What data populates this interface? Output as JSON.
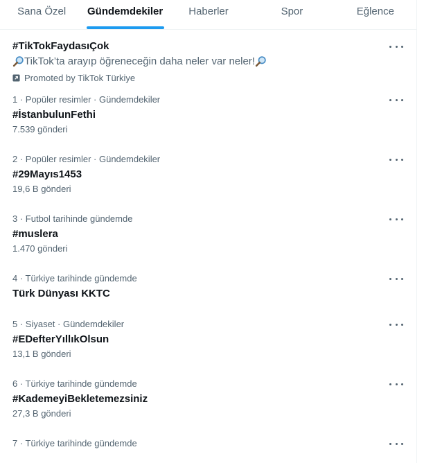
{
  "tabs": [
    {
      "label": "Sana Özel",
      "active": false
    },
    {
      "label": "Gündemdekiler",
      "active": true
    },
    {
      "label": "Haberler",
      "active": false
    },
    {
      "label": "Spor",
      "active": false
    },
    {
      "label": "Eğlence",
      "active": false
    }
  ],
  "promoted": {
    "title": "#TikTokFaydasıÇok",
    "description": "TikTok’ta arayıp öğreneceğin daha neler var neler!",
    "promoted_by": "Promoted by TikTok Türkiye",
    "description_icon": "magnifier-icon"
  },
  "trends": [
    {
      "meta": "1 · Popüler resimler · Gündemdekiler",
      "title": "#İstanbulunFethi",
      "count": "7.539 gönderi"
    },
    {
      "meta": "2 · Popüler resimler · Gündemdekiler",
      "title": "#29Mayıs1453",
      "count": "19,6 B gönderi"
    },
    {
      "meta": "3 · Futbol tarihinde gündemde",
      "title": "#muslera",
      "count": "1.470 gönderi"
    },
    {
      "meta": "4 · Türkiye tarihinde gündemde",
      "title": "Türk Dünyası KKTC",
      "count": ""
    },
    {
      "meta": "5 · Siyaset · Gündemdekiler",
      "title": "#EDefterYıllıkOlsun",
      "count": "13,1 B gönderi"
    },
    {
      "meta": "6 · Türkiye tarihinde gündemde",
      "title": "#KademeyiBekletemezsiniz",
      "count": "27,3 B gönderi"
    },
    {
      "meta": "7 · Türkiye tarihinde gündemde",
      "title": "",
      "count": ""
    }
  ],
  "colors": {
    "accent": "#1d9bf0",
    "text": "#0f1419",
    "secondary": "#536471"
  }
}
